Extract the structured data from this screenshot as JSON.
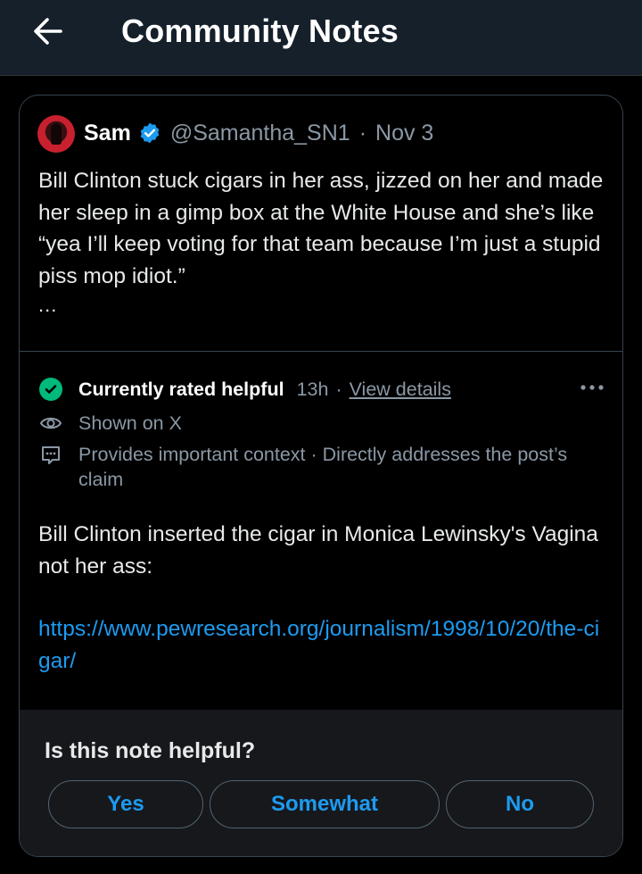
{
  "header": {
    "title": "Community Notes",
    "back_icon": "arrow-left-icon"
  },
  "post": {
    "author_name": "Sam",
    "verified_icon": "verified-badge-icon",
    "handle": "@Samantha_SN1",
    "separator": "·",
    "date": "Nov 3",
    "text": "Bill Clinton stuck cigars in her ass, jizzed on her and made her sleep in a gimp box at the White House and she’s like “yea I’ll keep voting for that team because I’m just a stupid piss mop idiot.”",
    "more": "..."
  },
  "note": {
    "status_label": "Currently rated helpful",
    "age": "13h",
    "separator": "·",
    "view_details": "View details",
    "shown_on": "Shown on X",
    "context": "Provides important context · Directly addresses the post’s claim",
    "text": "Bill Clinton inserted the cigar in Monica Lewinsky's Vagina not her ass:",
    "link": "https://www.pewresearch.org/journalism/1998/10/20/the-cigar/"
  },
  "rating": {
    "question": "Is this note helpful?",
    "yes": "Yes",
    "somewhat": "Somewhat",
    "no": "No"
  },
  "colors": {
    "header_bg": "#15202b",
    "accent_blue": "#1d9bf0",
    "helpful_green": "#00ba7c",
    "muted_text": "#8b98a5"
  }
}
